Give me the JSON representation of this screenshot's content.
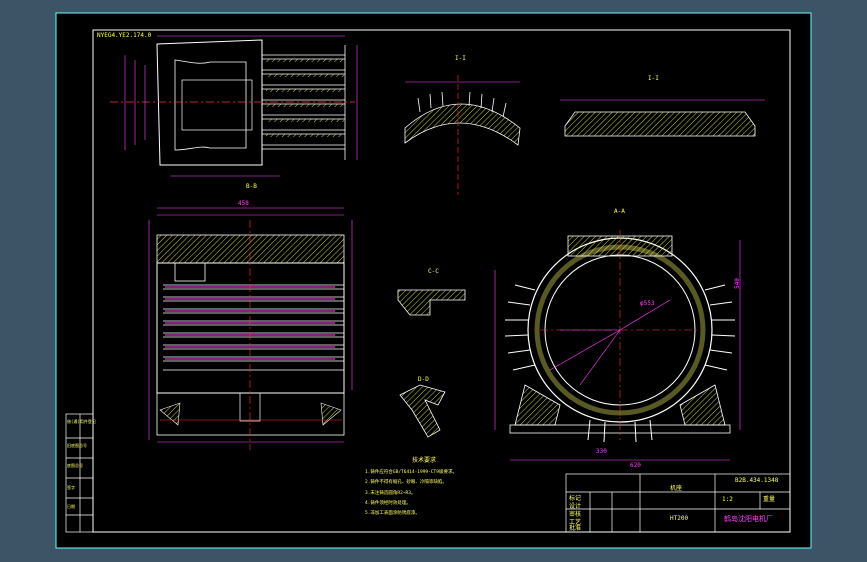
{
  "drawing": {
    "corner_code": "NYEG4.YE2.174.0",
    "section_labels": [
      "I-I",
      "I-I",
      "B-B",
      "A-A",
      "C-C",
      "D-D"
    ],
    "notes_title": "技术要求",
    "notes": [
      "1.铸件应符合GB/T6414-1999-CT9级要求。",
      "2.铸件不得有缩孔、砂眼、冷隔等缺陷。",
      "3.未注铸造圆角R2~R3。",
      "4.铸件须经时效处理。",
      "5.非加工表面涂防锈底漆。"
    ],
    "dims": {
      "d553": "φ553",
      "d330": "330",
      "d620": "620",
      "d540": "540",
      "d458": "458"
    }
  },
  "title_block": {
    "drawing_number": "B2B.434.1348",
    "part_name": "机座",
    "material": "HT200",
    "scale": "1:2",
    "weight": "重量",
    "company": "鹤岛沈阳电机厂",
    "rows": [
      "标记",
      "设计",
      "审核",
      "工艺",
      "批准"
    ]
  },
  "side_labels": [
    "借(通)用件登记",
    "旧底图总号",
    "底图总号",
    "签字",
    "日期"
  ],
  "colors": {
    "background": "#3d5466",
    "sheet": "#000000",
    "border": "#ffffff",
    "dimension": "#ff44ff",
    "hatch": "#ffff66",
    "text": "#ffff66",
    "outline": "#ffffff",
    "centerline": "#ff3333",
    "highlight": "#33ff33"
  }
}
